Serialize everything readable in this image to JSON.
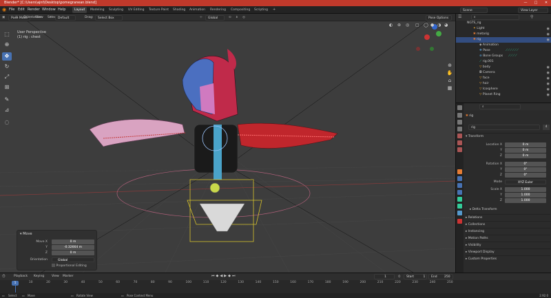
{
  "titlebar": {
    "text": "Blender* [C:\\Users\\ajnt\\Desktop\\pomegranean.blend]",
    "min": "—",
    "max": "□",
    "close": "✕"
  },
  "menu": [
    "File",
    "Edit",
    "Render",
    "Window",
    "Help"
  ],
  "workspaces": [
    "Layout",
    "Modeling",
    "Sculpting",
    "UV Editing",
    "Texture Paint",
    "Shading",
    "Animation",
    "Rendering",
    "Compositing",
    "Scripting"
  ],
  "scene": {
    "label": "Scene",
    "view_layer": "View Layer"
  },
  "viewport_header": {
    "mode": "Pose Mode",
    "menus": [
      "View",
      "Select",
      "Pose"
    ],
    "orientation_label": "Orientation:",
    "orientation_value": "Default",
    "drag_label": "Drag:",
    "drag_value": "Select Box",
    "pivot": "Global",
    "pose_options": "Pose Options"
  },
  "overlay_text": {
    "line1": "User Perspective",
    "line2": "(1) rig : chest"
  },
  "move_panel": {
    "title": "Move",
    "fields": [
      {
        "label": "Move X",
        "value": "0 m"
      },
      {
        "label": "Y",
        "value": "-0.32664 m"
      },
      {
        "label": "Z",
        "value": "0 m"
      }
    ],
    "orientation_label": "Orientation",
    "orientation_value": "Global",
    "proportional": "Proportional Editing"
  },
  "outliner": {
    "rows": [
      {
        "name": "NGTS_rig"
      },
      {
        "name": "Light"
      },
      {
        "name": "metarig"
      },
      {
        "name": "rig"
      },
      {
        "name": "Animation"
      },
      {
        "name": "Pose"
      },
      {
        "name": "Bone Groups"
      },
      {
        "name": "rig.001"
      },
      {
        "name": "body"
      },
      {
        "name": "Camera"
      },
      {
        "name": "face"
      },
      {
        "name": "hair"
      },
      {
        "name": "Icosphere"
      },
      {
        "name": "Planet Ring"
      }
    ]
  },
  "properties": {
    "object_name": "rig",
    "data_name": "rig",
    "users": "4",
    "transform": "Transform",
    "location": [
      {
        "label": "Location X",
        "value": "0 m"
      },
      {
        "label": "Y",
        "value": "0 m"
      },
      {
        "label": "Z",
        "value": "0 m"
      }
    ],
    "rotation": [
      {
        "label": "Rotation X",
        "value": "0°"
      },
      {
        "label": "Y",
        "value": "0°"
      },
      {
        "label": "Z",
        "value": "0°"
      }
    ],
    "mode_label": "Mode",
    "mode_value": "XYZ Euler",
    "scale": [
      {
        "label": "Scale X",
        "value": "1.000"
      },
      {
        "label": "Y",
        "value": "1.000"
      },
      {
        "label": "Z",
        "value": "1.000"
      }
    ],
    "delta": "Delta Transform",
    "sections": [
      "Relations",
      "Collections",
      "Instancing",
      "Motion Paths",
      "Visibility",
      "Viewport Display",
      "Custom Properties"
    ]
  },
  "timeline": {
    "menus": [
      "Playback",
      "Keying",
      "View",
      "Marker"
    ],
    "current_frame": "1",
    "start_label": "Start",
    "start_value": "1",
    "end_label": "End",
    "end_value": "250",
    "ticks": [
      "1",
      "10",
      "20",
      "30",
      "40",
      "50",
      "60",
      "70",
      "80",
      "90",
      "100",
      "110",
      "120",
      "130",
      "140",
      "150",
      "160",
      "170",
      "180",
      "190",
      "200",
      "210",
      "220",
      "230",
      "240",
      "250"
    ]
  },
  "statusbar": {
    "select": "Select",
    "move": "Move",
    "rotate": "Rotate View",
    "context": "Pose Context Menu",
    "version": "2.92.0"
  }
}
